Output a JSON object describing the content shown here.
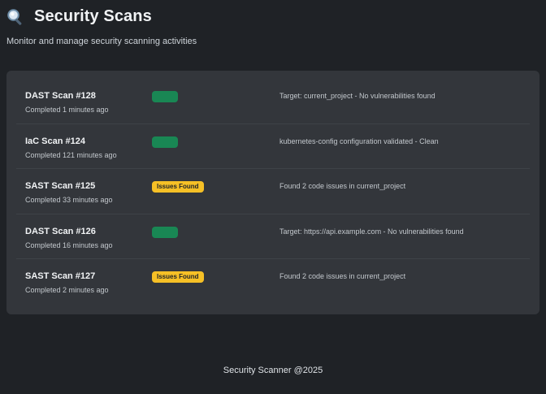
{
  "header": {
    "title": "Security Scans",
    "subtitle": "Monitor and manage security scanning activities",
    "icon": "search-icon"
  },
  "colors": {
    "background": "#1f2226",
    "card": "#33363b",
    "success": "#198754",
    "warning": "#f6c026"
  },
  "scans": [
    {
      "name": "DAST Scan #128",
      "completed": "Completed 1 minutes ago",
      "status": "success",
      "badge": "",
      "result": "Target: current_project - No vulnerabilities found"
    },
    {
      "name": "IaC Scan #124",
      "completed": "Completed 121 minutes ago",
      "status": "success",
      "badge": "",
      "result": "kubernetes-config configuration validated - Clean"
    },
    {
      "name": "SAST Scan #125",
      "completed": "Completed 33 minutes ago",
      "status": "warning",
      "badge": "Issues Found",
      "result": "Found 2 code issues in current_project"
    },
    {
      "name": "DAST Scan #126",
      "completed": "Completed 16 minutes ago",
      "status": "success",
      "badge": "",
      "result": "Target: https://api.example.com - No vulnerabilities found"
    },
    {
      "name": "SAST Scan #127",
      "completed": "Completed 2 minutes ago",
      "status": "warning",
      "badge": "Issues Found",
      "result": "Found 2 code issues in current_project"
    }
  ],
  "footer": {
    "text": "Security Scanner @2025"
  }
}
